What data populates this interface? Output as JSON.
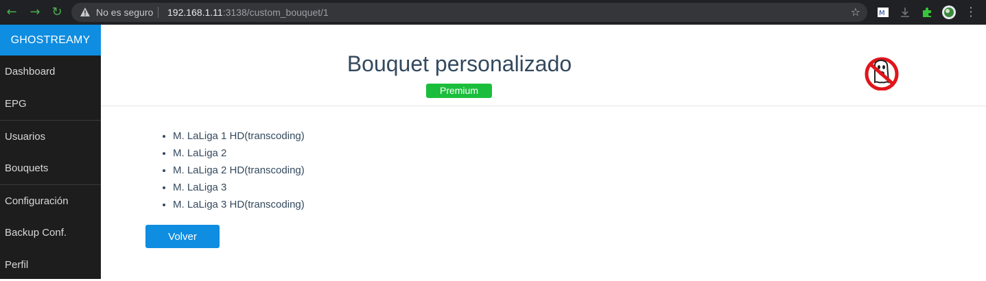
{
  "browser": {
    "back_icon": "arrow-left-icon",
    "security_label": "No es seguro",
    "url_host": "192.168.1.11",
    "url_path": ":3138/custom_bouquet/1"
  },
  "sidebar": {
    "brand": "GHOSTREAMY",
    "items": [
      {
        "label": "Dashboard"
      },
      {
        "label": "EPG"
      },
      {
        "label": "Usuarios"
      },
      {
        "label": "Bouquets"
      },
      {
        "label": "Configuración"
      },
      {
        "label": "Backup Conf."
      },
      {
        "label": "Perfil"
      }
    ]
  },
  "main": {
    "title": "Bouquet personalizado",
    "badge": "Premium",
    "channels": [
      "M. LaLiga 1 HD(transcoding)",
      "M. LaLiga 2",
      "M. LaLiga 2 HD(transcoding)",
      "M. LaLiga 3",
      "M. LaLiga 3 HD(transcoding)"
    ],
    "back_button": "Volver"
  },
  "colors": {
    "accent": "#0f8de0",
    "badge": "#1bbe3c",
    "sidebar_bg": "#1d1d1d",
    "title_text": "#34495e"
  }
}
